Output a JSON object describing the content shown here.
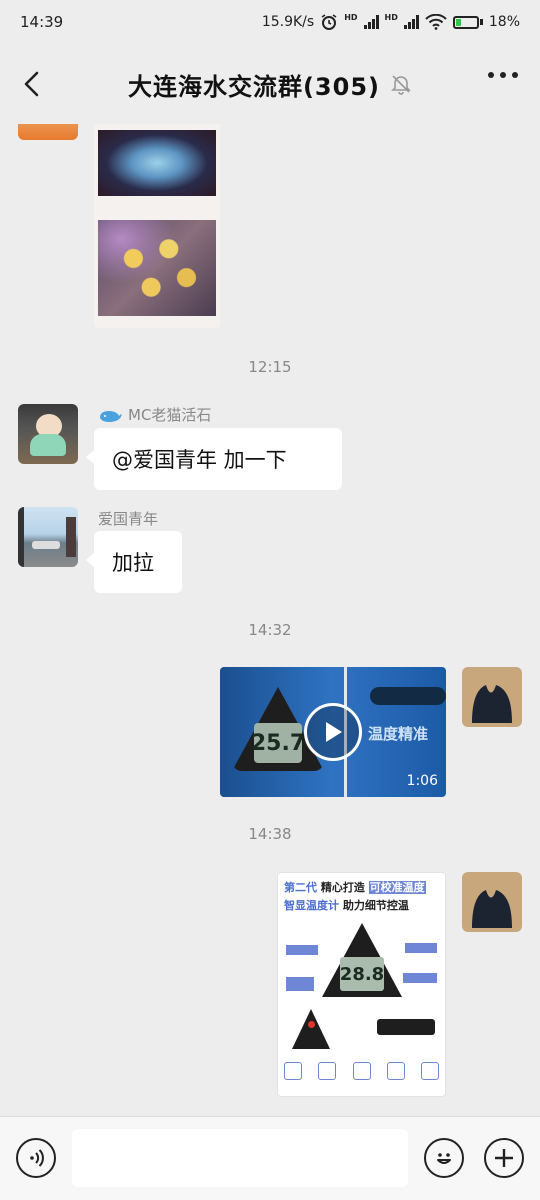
{
  "status_bar": {
    "time": "14:39",
    "net_speed": "15.9K/s",
    "hd1": "HD",
    "hd2": "HD",
    "battery": "18%"
  },
  "nav": {
    "title": "大连海水交流群(305)"
  },
  "messages": [
    {
      "type": "image",
      "side": "left",
      "description": "coral photos"
    },
    {
      "type": "timestamp",
      "text": "12:15"
    },
    {
      "type": "text",
      "side": "left",
      "sender": "MC老猫活石",
      "text": "@爱国青年  加一下"
    },
    {
      "type": "text",
      "side": "left",
      "sender": "爱国青年",
      "text": "加拉"
    },
    {
      "type": "timestamp",
      "text": "14:32"
    },
    {
      "type": "video",
      "side": "right",
      "duration": "1:06",
      "overlay_text": "温度精准",
      "thermo_reading": "25.7"
    },
    {
      "type": "timestamp",
      "text": "14:38"
    },
    {
      "type": "image",
      "side": "right",
      "ad_line1_blue": "第二代",
      "ad_line1_black": "精心打造",
      "ad_line1_highlight": "可校准温度",
      "ad_line2_blue": "智显温度计",
      "ad_line2_black": "助力细节控温",
      "thermo_reading": "28.8"
    }
  ],
  "input_bar": {
    "placeholder": ""
  },
  "colors": {
    "background": "#ededed",
    "bubble": "#ffffff",
    "timestamp": "#888888",
    "battery_green": "#37c24a"
  }
}
